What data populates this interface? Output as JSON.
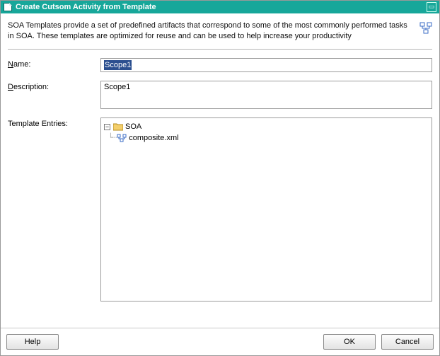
{
  "titlebar": {
    "title": "Create Cutsom Activity from Template"
  },
  "intro": "SOA Templates provide a set of predefined artifacts that correspond to some of the most commonly performed tasks in SOA. These templates are optimized for reuse and can be used to help increase your productivity",
  "form": {
    "name_label_pre": "N",
    "name_label_rest": "ame:",
    "name_value": "Scope1",
    "desc_label_pre": "D",
    "desc_label_rest": "escription:",
    "desc_value": "Scope1",
    "entries_label": "Template Entries:"
  },
  "tree": {
    "root": "SOA",
    "child": "composite.xml"
  },
  "buttons": {
    "help": "Help",
    "ok": "OK",
    "cancel": "Cancel"
  }
}
